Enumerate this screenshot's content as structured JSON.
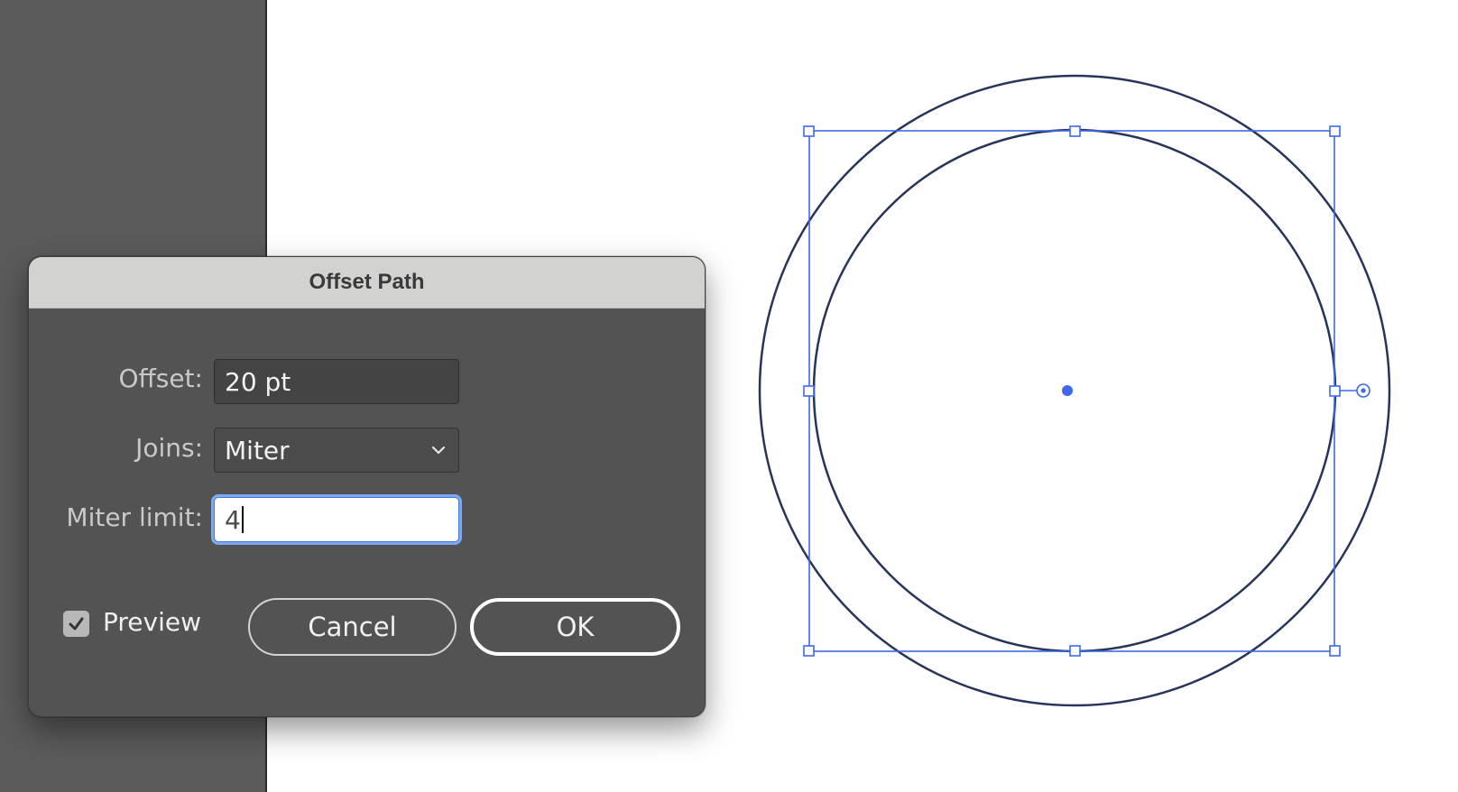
{
  "dialog": {
    "title": "Offset Path",
    "fields": {
      "offset_label": "Offset:",
      "offset_value": "20 pt",
      "joins_label": "Joins:",
      "joins_value": "Miter",
      "miter_label": "Miter limit:",
      "miter_value": "4"
    },
    "preview": {
      "label": "Preview",
      "checked": true
    },
    "buttons": {
      "cancel": "Cancel",
      "ok": "OK"
    }
  },
  "colors": {
    "dialog_bg": "#535353",
    "titlebar_bg": "#d2d2d0",
    "selection_blue": "#3f69e8",
    "path_stroke": "#27355c",
    "panel_bg": "#5b5b5b"
  }
}
